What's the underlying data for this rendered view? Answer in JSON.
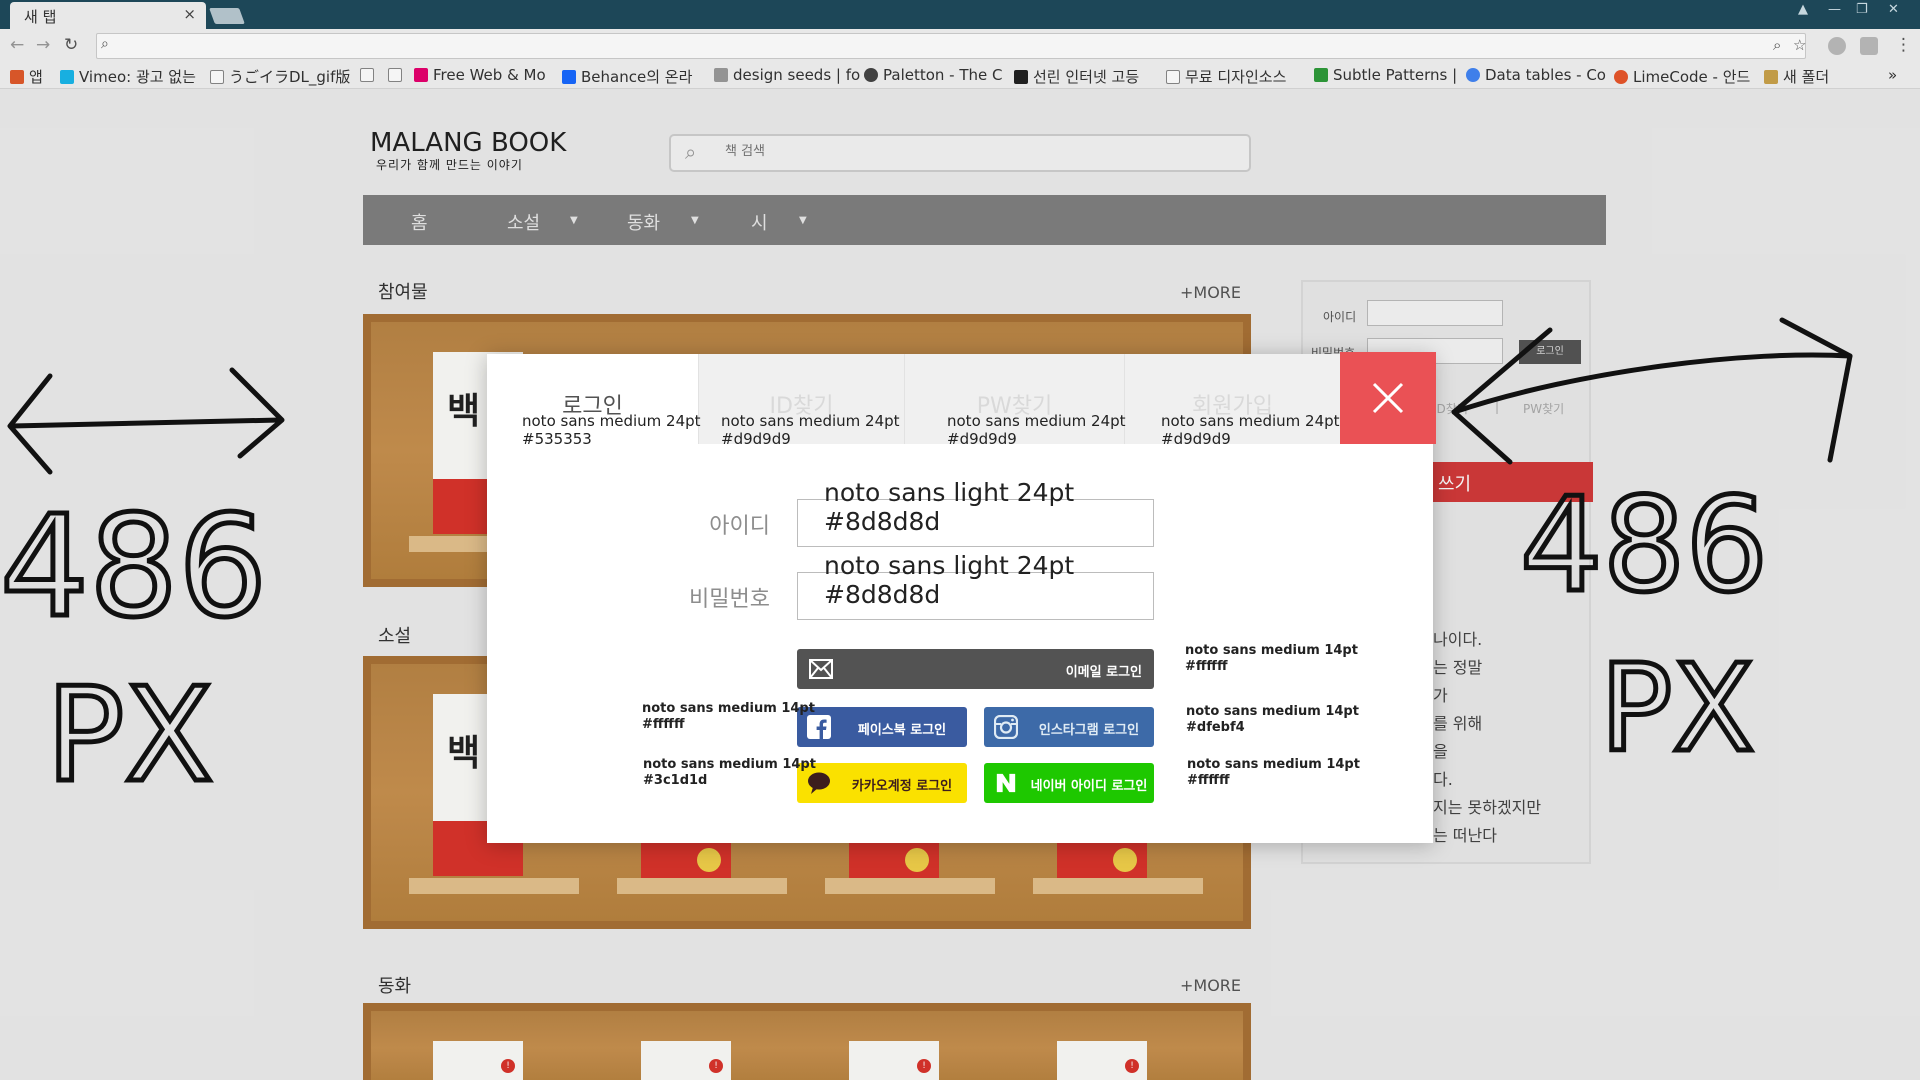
{
  "browser": {
    "tab_title": "새 탭",
    "tab_close": "×",
    "window_controls": [
      "▲",
      "—",
      "❐",
      "✕"
    ],
    "bookmarks": [
      {
        "label": "앱",
        "color": "#e05a2b"
      },
      {
        "label": "Vimeo: 광고 없는",
        "color": "#1ab7ea"
      },
      {
        "label": "うごイラDL_gif版",
        "color": "#888888"
      },
      {
        "label": "",
        "color": "#888888"
      },
      {
        "label": "",
        "color": "#888888"
      },
      {
        "label": "Free Web & Mo",
        "color": "#e5006e"
      },
      {
        "label": "Behance의 온라",
        "color": "#1769ff"
      },
      {
        "label": "design seeds | fo",
        "color": "#999999"
      },
      {
        "label": "Paletton - The C",
        "color": "#444444"
      },
      {
        "label": "선린 인터넷 고등",
        "color": "#222222"
      },
      {
        "label": "무료 디자인소스",
        "color": "#888888"
      },
      {
        "label": "Subtle Patterns |",
        "color": "#2e9b3a"
      },
      {
        "label": "Data tables - Co",
        "color": "#4285f4"
      },
      {
        "label": "LimeCode - 안드",
        "color": "#e8562a"
      },
      {
        "label": "새 폴더",
        "color": "#c9a24a"
      }
    ],
    "overflow": "»"
  },
  "site": {
    "logo_title": "MALANG BOOK",
    "logo_sub": "우리가 함께 만드는 이야기",
    "search_placeholder": "책 검색",
    "menu": [
      "홈",
      "소설",
      "동화",
      "시"
    ],
    "sections": [
      {
        "title": "참여물",
        "more": "+MORE"
      },
      {
        "title": "소설",
        "more": ""
      },
      {
        "title": "동화",
        "more": "+MORE"
      }
    ],
    "book_title": "백",
    "sidebar": {
      "id_label": "아이디",
      "pw_label": "비밀번호",
      "login_button": "로그인",
      "find_id": "ID찾기",
      "separator": "|",
      "find_pw": "PW찾기",
      "write_button": "쓰기",
      "intro_lines": [
        "나이다.",
        "는 정말",
        "가",
        "를 위해",
        "을",
        "다.",
        "지는 못하겠지만",
        "는 떠난다"
      ]
    }
  },
  "annotations": {
    "left_number": "486",
    "left_unit": "PX",
    "right_number": "486",
    "right_unit": "PX"
  },
  "modal": {
    "tabs": [
      {
        "label": "로그인",
        "note": "noto sans medium 24pt\n#535353",
        "active": true
      },
      {
        "label": "ID찾기",
        "note": "noto sans medium 24pt\n#d9d9d9",
        "active": false
      },
      {
        "label": "PW찾기",
        "note": "noto sans medium 24pt\n#d9d9d9",
        "active": false
      },
      {
        "label": "회원가입",
        "note": "noto sans medium 24pt\n#d9d9d9",
        "active": false
      }
    ],
    "id_label": "아이디",
    "pw_label": "비밀번호",
    "id_hint": "noto sans light 24pt\n#8d8d8d",
    "pw_hint": "noto sans light 24pt\n#8d8d8d",
    "buttons": {
      "email": "이메일 로그인",
      "facebook": "페이스북 로그인",
      "instagram": "인스타그램 로그인",
      "kakao": "카카오계정 로그인",
      "naver": "네이버 아이디 로그인"
    },
    "notes": {
      "email": "noto sans medium 14pt\n#ffffff",
      "facebook": "noto sans medium 14pt\n#ffffff",
      "instagram": "noto sans medium 14pt\n#dfebf4",
      "kakao": "noto sans medium 14pt\n#3c1d1d",
      "naver": "noto sans medium 14pt\n#ffffff"
    },
    "colors": {
      "close": "#ea5155",
      "email": "#535353",
      "facebook": "#3a5ba0",
      "instagram": "#3d6aa8",
      "kakao": "#fae100",
      "naver": "#1ec800"
    }
  }
}
